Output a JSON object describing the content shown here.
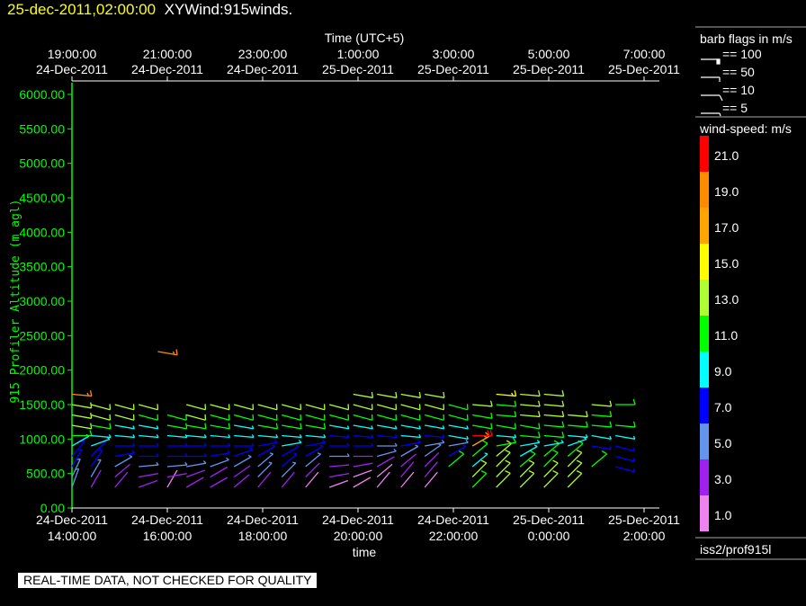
{
  "header": {
    "datetime": "25-dec-2011,02:00:00",
    "product": "XYWind:915winds."
  },
  "footer": {
    "qc_notice": "REAL-TIME DATA, NOT CHECKED FOR QUALITY"
  },
  "legend": {
    "barb_title": "barb flags in m/s",
    "barbs": [
      {
        "label": "== 100",
        "value": 100
      },
      {
        "label": "== 50",
        "value": 50
      },
      {
        "label": "== 10",
        "value": 10
      },
      {
        "label": "== 5",
        "value": 5
      }
    ],
    "colorbar_title": "wind-speed: m/s",
    "colorbar": [
      {
        "label": "21.0",
        "color": "#ff0000"
      },
      {
        "label": "19.0",
        "color": "#ff8c00"
      },
      {
        "label": "17.0",
        "color": "#ffa500"
      },
      {
        "label": "15.0",
        "color": "#ffff00"
      },
      {
        "label": "13.0",
        "color": "#adff2f"
      },
      {
        "label": "11.0",
        "color": "#00ff00"
      },
      {
        "label": "9.0",
        "color": "#00ffff"
      },
      {
        "label": "7.0",
        "color": "#0000ff"
      },
      {
        "label": "5.0",
        "color": "#6495ed"
      },
      {
        "label": "3.0",
        "color": "#a020f0"
      },
      {
        "label": "1.0",
        "color": "#ee82ee"
      }
    ],
    "source": "iss2/prof915l"
  },
  "chart_data": {
    "type": "wind-barb",
    "xlabel": "time",
    "top_xlabel": "Time (UTC+5)",
    "ylabel": "915 Profiler Altitude (m agl)",
    "ylim": [
      0,
      6000
    ],
    "xlim_hours_from_14": [
      0,
      12.33
    ],
    "yticks": [
      "0.00",
      "500.00",
      "1000.00",
      "1500.00",
      "2000.00",
      "2500.00",
      "3000.00",
      "3500.00",
      "4000.00",
      "4500.00",
      "5000.00",
      "5500.00",
      "6000.00"
    ],
    "xticks": [
      {
        "h": 0,
        "date": "24-Dec-2011",
        "time": "14:00:00"
      },
      {
        "h": 2,
        "date": "24-Dec-2011",
        "time": "16:00:00"
      },
      {
        "h": 4,
        "date": "24-Dec-2011",
        "time": "18:00:00"
      },
      {
        "h": 6,
        "date": "24-Dec-2011",
        "time": "20:00:00"
      },
      {
        "h": 8,
        "date": "24-Dec-2011",
        "time": "22:00:00"
      },
      {
        "h": 10,
        "date": "25-Dec-2011",
        "time": "0:00:00"
      },
      {
        "h": 12,
        "date": "25-Dec-2011",
        "time": "2:00:00"
      }
    ],
    "top_xticks": [
      {
        "h": 0,
        "time": "19:00:00",
        "date": "24-Dec-2011"
      },
      {
        "h": 2,
        "time": "21:00:00",
        "date": "24-Dec-2011"
      },
      {
        "h": 4,
        "time": "23:00:00",
        "date": "24-Dec-2011"
      },
      {
        "h": 6,
        "time": "1:00:00",
        "date": "25-Dec-2011"
      },
      {
        "h": 8,
        "time": "3:00:00",
        "date": "25-Dec-2011"
      },
      {
        "h": 10,
        "time": "5:00:00",
        "date": "25-Dec-2011"
      },
      {
        "h": 12,
        "time": "7:00:00",
        "date": "25-Dec-2011"
      }
    ],
    "altitudes": [
      300,
      450,
      600,
      750,
      900,
      1050,
      1200,
      1350,
      1500,
      1650
    ],
    "profiles": [
      {
        "t": 0.0,
        "speed": [
          5,
          5,
          7,
          7,
          9,
          11,
          13,
          13,
          13,
          19
        ],
        "dir": [
          20,
          25,
          30,
          40,
          60,
          90,
          100,
          100,
          100,
          95
        ]
      },
      {
        "t": 0.4,
        "speed": [
          3,
          5,
          7,
          7,
          9,
          9,
          11,
          13,
          13,
          null
        ],
        "dir": [
          30,
          30,
          35,
          45,
          70,
          95,
          100,
          105,
          105,
          null
        ]
      },
      {
        "t": 0.9,
        "speed": [
          3,
          3,
          5,
          7,
          7,
          9,
          9,
          13,
          13,
          null
        ],
        "dir": [
          40,
          50,
          60,
          80,
          90,
          95,
          100,
          105,
          105,
          null
        ]
      },
      {
        "t": 1.4,
        "speed": [
          3,
          3,
          5,
          7,
          7,
          9,
          9,
          11,
          13,
          null
        ],
        "dir": [
          70,
          80,
          85,
          90,
          90,
          95,
          100,
          105,
          105,
          null
        ]
      },
      {
        "t": 2.0,
        "speed": [
          1,
          3,
          5,
          7,
          7,
          9,
          11,
          11,
          null,
          null
        ],
        "dir": [
          30,
          80,
          85,
          90,
          90,
          95,
          100,
          105,
          null,
          null
        ]
      },
      {
        "t": 2.4,
        "speed": [
          3,
          3,
          5,
          7,
          7,
          9,
          11,
          13,
          13,
          null
        ],
        "dir": [
          60,
          70,
          80,
          90,
          90,
          95,
          100,
          105,
          105,
          null
        ]
      },
      {
        "t": 2.9,
        "speed": [
          3,
          3,
          5,
          7,
          7,
          9,
          11,
          11,
          13,
          null
        ],
        "dir": [
          60,
          60,
          70,
          80,
          90,
          95,
          100,
          105,
          105,
          null
        ]
      },
      {
        "t": 3.4,
        "speed": [
          3,
          3,
          5,
          7,
          7,
          9,
          9,
          11,
          13,
          null
        ],
        "dir": [
          50,
          55,
          60,
          70,
          90,
          95,
          100,
          105,
          105,
          null
        ]
      },
      {
        "t": 3.9,
        "speed": [
          3,
          5,
          5,
          7,
          7,
          9,
          11,
          11,
          13,
          null
        ],
        "dir": [
          40,
          45,
          50,
          60,
          80,
          95,
          100,
          105,
          105,
          null
        ]
      },
      {
        "t": 4.4,
        "speed": [
          3,
          5,
          7,
          7,
          9,
          9,
          11,
          11,
          13,
          null
        ],
        "dir": [
          40,
          45,
          50,
          60,
          80,
          95,
          100,
          105,
          105,
          null
        ]
      },
      {
        "t": 4.9,
        "speed": [
          1,
          3,
          5,
          7,
          7,
          9,
          11,
          11,
          13,
          null
        ],
        "dir": [
          40,
          45,
          50,
          60,
          80,
          95,
          100,
          105,
          105,
          null
        ]
      },
      {
        "t": 5.4,
        "speed": [
          1,
          3,
          3,
          5,
          7,
          7,
          9,
          11,
          13,
          null
        ],
        "dir": [
          70,
          80,
          85,
          90,
          90,
          95,
          100,
          105,
          105,
          null
        ]
      },
      {
        "t": 5.9,
        "speed": [
          1,
          1,
          3,
          3,
          7,
          7,
          9,
          11,
          13,
          13
        ],
        "dir": [
          60,
          70,
          80,
          90,
          90,
          95,
          100,
          105,
          105,
          100
        ]
      },
      {
        "t": 6.4,
        "speed": [
          1,
          1,
          3,
          5,
          5,
          7,
          9,
          11,
          13,
          13
        ],
        "dir": [
          40,
          50,
          60,
          75,
          90,
          95,
          100,
          105,
          105,
          100
        ]
      },
      {
        "t": 6.9,
        "speed": [
          1,
          3,
          3,
          5,
          7,
          9,
          9,
          11,
          13,
          13
        ],
        "dir": [
          40,
          40,
          50,
          60,
          80,
          95,
          100,
          105,
          105,
          100
        ]
      },
      {
        "t": 7.4,
        "speed": [
          1,
          3,
          3,
          5,
          5,
          7,
          9,
          11,
          13,
          13
        ],
        "dir": [
          40,
          40,
          45,
          55,
          80,
          95,
          100,
          105,
          105,
          100
        ]
      },
      {
        "t": 7.9,
        "speed": [
          null,
          null,
          11,
          7,
          5,
          9,
          9,
          11,
          11,
          null
        ],
        "dir": [
          null,
          null,
          50,
          60,
          80,
          100,
          100,
          105,
          105,
          null
        ]
      },
      {
        "t": 8.4,
        "speed": [
          11,
          13,
          9,
          11,
          17,
          21,
          11,
          11,
          13,
          null
        ],
        "dir": [
          45,
          45,
          50,
          50,
          60,
          90,
          100,
          100,
          95,
          null
        ]
      },
      {
        "t": 8.9,
        "speed": [
          13,
          13,
          13,
          13,
          11,
          9,
          11,
          11,
          11,
          15
        ],
        "dir": [
          45,
          45,
          45,
          50,
          80,
          95,
          100,
          95,
          95,
          95
        ]
      },
      {
        "t": 9.4,
        "speed": [
          13,
          13,
          11,
          9,
          9,
          11,
          11,
          13,
          13,
          13
        ],
        "dir": [
          45,
          45,
          50,
          60,
          80,
          95,
          100,
          95,
          95,
          95
        ]
      },
      {
        "t": 9.9,
        "speed": [
          13,
          13,
          11,
          11,
          9,
          11,
          11,
          13,
          13,
          13
        ],
        "dir": [
          45,
          45,
          45,
          50,
          80,
          95,
          95,
          95,
          95,
          95
        ]
      },
      {
        "t": 10.4,
        "speed": [
          13,
          13,
          13,
          11,
          9,
          9,
          11,
          13,
          null,
          null
        ],
        "dir": [
          45,
          45,
          45,
          50,
          70,
          95,
          95,
          95,
          null,
          null
        ]
      },
      {
        "t": 10.9,
        "speed": [
          null,
          null,
          11,
          null,
          7,
          9,
          11,
          11,
          13,
          null
        ],
        "dir": [
          null,
          null,
          50,
          null,
          100,
          100,
          95,
          95,
          95,
          null
        ]
      },
      {
        "t": 11.4,
        "speed": [
          null,
          null,
          7,
          7,
          7,
          9,
          11,
          null,
          11,
          null
        ],
        "dir": [
          null,
          null,
          105,
          105,
          105,
          100,
          95,
          null,
          90,
          null
        ]
      }
    ],
    "isolated": [
      {
        "t": 1.8,
        "alt": 2270,
        "speed": 19,
        "dir": 100
      }
    ]
  }
}
